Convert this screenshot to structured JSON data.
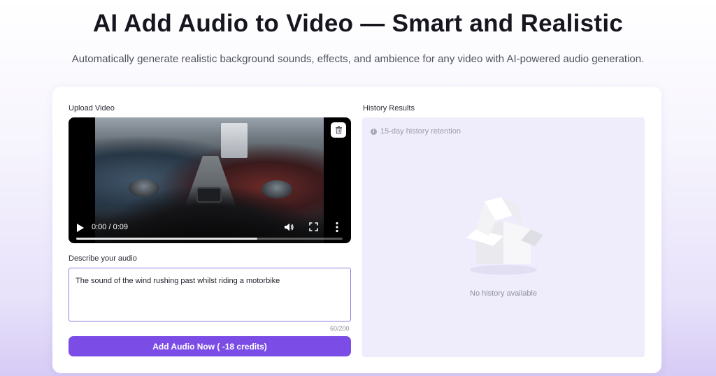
{
  "header": {
    "title": "AI Add Audio to Video — Smart and Realistic",
    "subtitle": "Automatically generate realistic background sounds, effects, and ambience for any video with AI-powered audio generation."
  },
  "upload": {
    "label": "Upload Video",
    "delete_icon": "trash-icon",
    "video": {
      "time": "0:00 / 0:09",
      "progress": 0.68,
      "play_icon": "play-icon",
      "volume_icon": "volume-icon",
      "fullscreen_icon": "fullscreen-icon",
      "more_icon": "more-vertical-icon"
    }
  },
  "prompt": {
    "label": "Describe your audio",
    "value": "The sound of the wind rushing past whilst riding a motorbike",
    "char_count": "60/200"
  },
  "submit": {
    "label": "Add Audio Now ( -18 credits)"
  },
  "history": {
    "label": "History Results",
    "retention": "15-day history retention",
    "empty_text": "No history available",
    "empty_icon": "empty-box-icon",
    "info_icon": "info-icon"
  },
  "colors": {
    "accent": "#7b4de6",
    "panel": "#efecfc",
    "input_border": "#8a7de0"
  }
}
